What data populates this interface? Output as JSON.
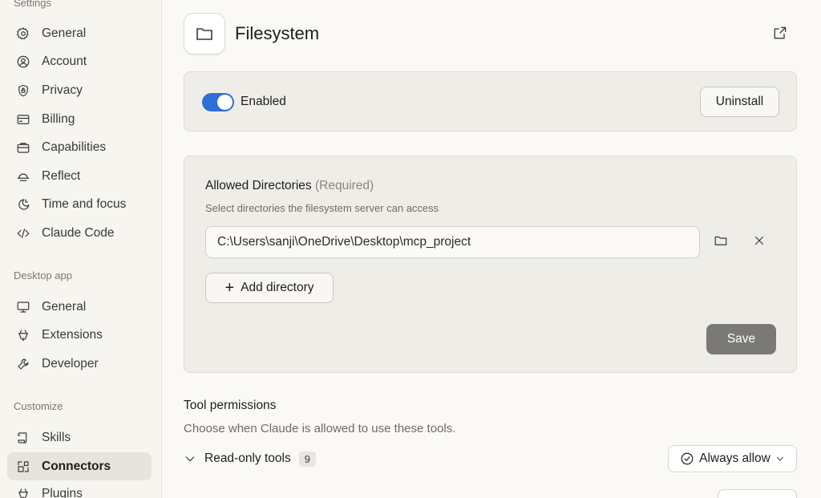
{
  "sidebar": {
    "settings_label": "Settings",
    "settings_items": [
      {
        "label": "General",
        "icon": "gear-icon"
      },
      {
        "label": "Account",
        "icon": "user-circle-icon"
      },
      {
        "label": "Privacy",
        "icon": "shield-lock-icon"
      },
      {
        "label": "Billing",
        "icon": "credit-card-icon"
      },
      {
        "label": "Capabilities",
        "icon": "briefcase-icon"
      },
      {
        "label": "Reflect",
        "icon": "sunrise-icon"
      },
      {
        "label": "Time and focus",
        "icon": "moon-clock-icon"
      },
      {
        "label": "Claude Code",
        "icon": "code-brackets-icon"
      }
    ],
    "desktop_label": "Desktop app",
    "desktop_items": [
      {
        "label": "General",
        "icon": "monitor-icon"
      },
      {
        "label": "Extensions",
        "icon": "plug-icon"
      },
      {
        "label": "Developer",
        "icon": "wrench-icon"
      }
    ],
    "customize_label": "Customize",
    "customize_items": [
      {
        "label": "Skills",
        "icon": "scroll-icon"
      },
      {
        "label": "Connectors",
        "icon": "connectors-grid-icon",
        "active": true
      },
      {
        "label": "Plugins",
        "icon": "plug-icon"
      }
    ]
  },
  "header": {
    "title": "Filesystem",
    "icon": "folder-icon"
  },
  "enabled_card": {
    "toggle_label": "Enabled",
    "toggle_on": true,
    "uninstall_label": "Uninstall"
  },
  "directories": {
    "title": "Allowed Directories",
    "required": "(Required)",
    "subtitle": "Select directories the filesystem server can access",
    "path_value": "C:\\Users\\sanji\\OneDrive\\Desktop\\mcp_project",
    "add_label": "Add directory",
    "save_label": "Save"
  },
  "tool_permissions": {
    "title": "Tool permissions",
    "subtitle": "Choose when Claude is allowed to use these tools.",
    "group_label": "Read-only tools",
    "group_count": "9",
    "policy_label": "Always allow"
  },
  "colors": {
    "accent": "#2f6ed6",
    "save_disabled": "#7a7975",
    "card_bg": "#eeede8",
    "sidebar_active": "#e6e4dd"
  }
}
